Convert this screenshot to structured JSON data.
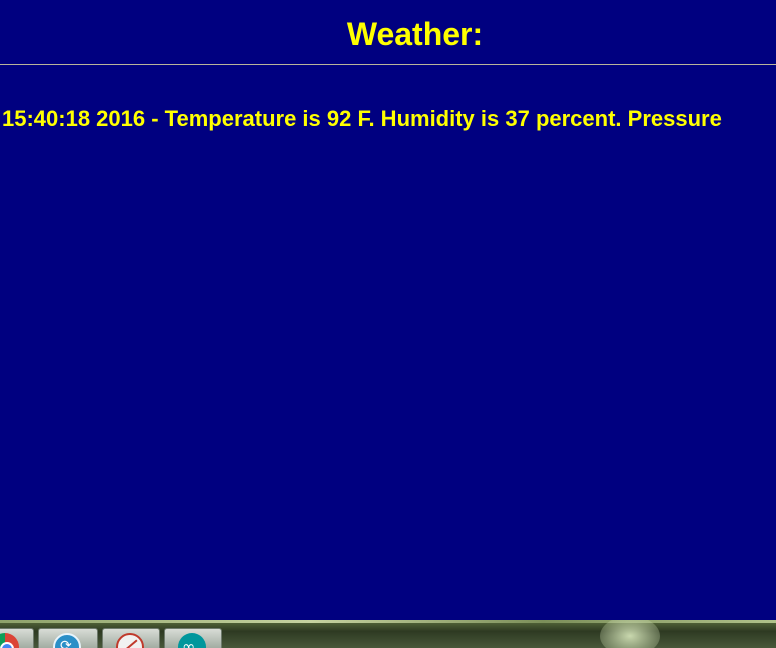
{
  "page": {
    "heading": "Weather:",
    "reading": "15:40:18 2016 - Temperature is 92 F. Humidity is 37 percent. Pressure"
  },
  "taskbar": {
    "apps": [
      {
        "icon": "chrome-icon"
      },
      {
        "icon": "sync-app-icon"
      },
      {
        "icon": "no-entry-app-icon"
      },
      {
        "icon": "arduino-icon"
      }
    ]
  },
  "colors": {
    "background": "#000080",
    "text": "#ffff00",
    "rule": "#b9b39a"
  }
}
